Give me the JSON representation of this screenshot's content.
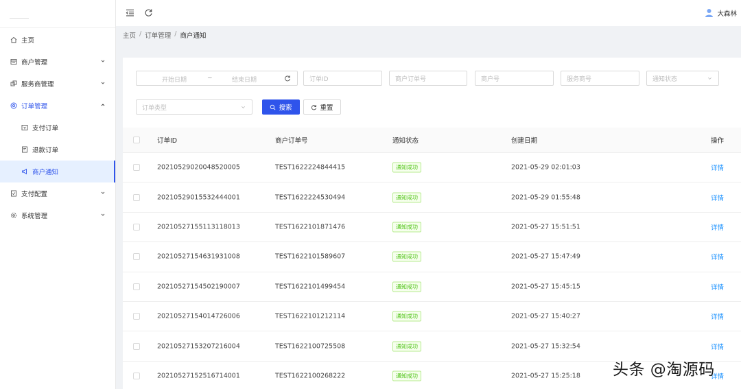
{
  "sidebar": {
    "items": [
      {
        "label": "主页",
        "icon": "home-icon"
      },
      {
        "label": "商户管理",
        "icon": "merchant-icon"
      },
      {
        "label": "服务商管理",
        "icon": "provider-icon"
      },
      {
        "label": "订单管理",
        "icon": "order-icon"
      },
      {
        "label": "支付订单",
        "icon": "pay-order-icon"
      },
      {
        "label": "退款订单",
        "icon": "refund-order-icon"
      },
      {
        "label": "商户通知",
        "icon": "notify-icon"
      },
      {
        "label": "支付配置",
        "icon": "pay-config-icon"
      },
      {
        "label": "系统管理",
        "icon": "settings-icon"
      }
    ]
  },
  "header": {
    "user_name": "大森林"
  },
  "breadcrumb": [
    "主页",
    "订单管理",
    "商户通知"
  ],
  "breadcrumb_sep": "/",
  "filters": {
    "start_date": "开始日期",
    "tilde": "~",
    "end_date": "结束日期",
    "order_id": "订单ID",
    "merchant_order_no": "商户订单号",
    "merchant_no": "商户号",
    "provider_no": "服务商号",
    "notify_status": "通知状态",
    "order_type": "订单类型",
    "search_label": "搜索",
    "reset_label": "重置"
  },
  "table": {
    "columns": [
      "订单ID",
      "商户订单号",
      "通知状态",
      "创建日期",
      "操作"
    ],
    "rows": [
      {
        "id": "20210529020048520005",
        "mo": "TEST1622224844415",
        "status": "通知成功",
        "date": "2021-05-29 02:01:03",
        "op": "详情"
      },
      {
        "id": "20210529015532444001",
        "mo": "TEST1622224530494",
        "status": "通知成功",
        "date": "2021-05-29 01:55:48",
        "op": "详情"
      },
      {
        "id": "20210527155113118013",
        "mo": "TEST1622101871476",
        "status": "通知成功",
        "date": "2021-05-27 15:51:51",
        "op": "详情"
      },
      {
        "id": "20210527154631931008",
        "mo": "TEST1622101589607",
        "status": "通知成功",
        "date": "2021-05-27 15:47:49",
        "op": "详情"
      },
      {
        "id": "20210527154502190007",
        "mo": "TEST1622101499454",
        "status": "通知成功",
        "date": "2021-05-27 15:45:15",
        "op": "详情"
      },
      {
        "id": "20210527154014726006",
        "mo": "TEST1622101212114",
        "status": "通知成功",
        "date": "2021-05-27 15:40:27",
        "op": "详情"
      },
      {
        "id": "20210527153207216004",
        "mo": "TEST1622100725508",
        "status": "通知成功",
        "date": "2021-05-27 15:32:54",
        "op": "详情"
      },
      {
        "id": "20210527152516714001",
        "mo": "TEST1622100268222",
        "status": "通知成功",
        "date": "2021-05-27 15:25:18",
        "op": "详情"
      }
    ]
  },
  "watermark": "头条 @淘源码",
  "colors": {
    "primary": "#2f54eb",
    "success": "#52c41a",
    "link": "#1890ff"
  }
}
